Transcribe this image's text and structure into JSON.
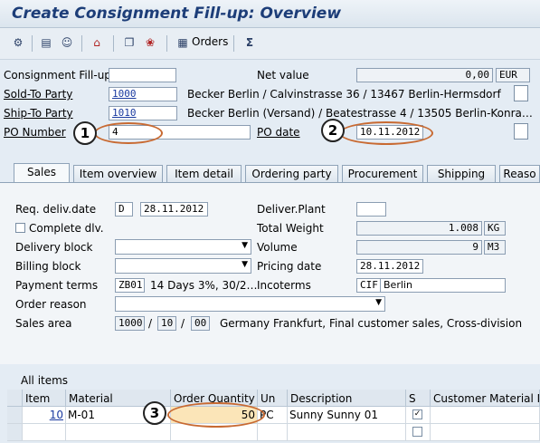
{
  "title": "Create Consignment Fill-up: Overview",
  "toolbar": {
    "orders_label": "Orders"
  },
  "header": {
    "fillup_label": "Consignment Fill-up",
    "fillup_value": "",
    "net_value_label": "Net value",
    "net_value": "0,00",
    "currency": "EUR",
    "sold_to_label": "Sold-To Party",
    "sold_to_value": "1000",
    "sold_to_text": "Becker Berlin / Calvinstrasse 36 / 13467 Berlin-Hermsdorf",
    "ship_to_label": "Ship-To Party",
    "ship_to_value": "1010",
    "ship_to_text": "Becker Berlin (Versand) / Beatestrasse 4 / 13505 Berlin-Konra…",
    "po_number_label": "PO Number",
    "po_number_value": "4",
    "po_date_label": "PO date",
    "po_date_value": "10.11.2012"
  },
  "tabs": [
    "Sales",
    "Item overview",
    "Item detail",
    "Ordering party",
    "Procurement",
    "Shipping",
    "Reaso"
  ],
  "sales": {
    "req_deliv_label": "Req. deliv.date",
    "req_deliv_type": "D",
    "req_deliv_date": "28.11.2012",
    "deliver_plant_label": "Deliver.Plant",
    "complete_dlv_label": "Complete dlv.",
    "total_weight_label": "Total Weight",
    "total_weight_value": "1.008",
    "total_weight_unit": "KG",
    "delivery_block_label": "Delivery block",
    "volume_label": "Volume",
    "volume_value": "9",
    "volume_unit": "M3",
    "billing_block_label": "Billing block",
    "pricing_date_label": "Pricing date",
    "pricing_date_value": "28.11.2012",
    "payment_terms_label": "Payment terms",
    "payment_terms_value": "ZB01",
    "payment_terms_text": "14 Days 3%, 30/2…",
    "incoterms_label": "Incoterms",
    "incoterms_code": "CIF",
    "incoterms_place": "Berlin",
    "order_reason_label": "Order reason",
    "sales_area_label": "Sales area",
    "sales_org": "1000",
    "dist_channel": "10",
    "division": "00",
    "sales_area_text": "Germany Frankfurt, Final customer sales, Cross-division"
  },
  "items": {
    "section_label": "All items",
    "columns": [
      "Item",
      "Material",
      "Order Quantity",
      "Un",
      "Description",
      "S",
      "Customer Material Nu"
    ],
    "rows": [
      {
        "item": "10",
        "material": "M-01",
        "qty": "50",
        "unit": "PC",
        "description": "Sunny Sunny 01"
      }
    ]
  },
  "callouts": [
    "1",
    "2",
    "3"
  ]
}
